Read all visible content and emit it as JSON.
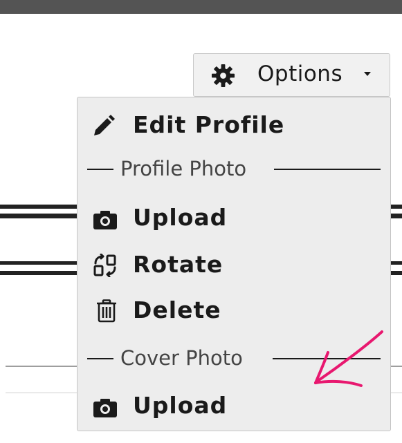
{
  "options_button": {
    "label": "Options",
    "icon": "gear-icon",
    "caret_icon": "caret-down-icon"
  },
  "menu": {
    "edit_profile": {
      "label": "Edit Profile",
      "icon": "pencil-icon"
    },
    "profile_photo_section": "Profile Photo",
    "profile_upload": {
      "label": "Upload",
      "icon": "camera-icon"
    },
    "rotate": {
      "label": "Rotate",
      "icon": "rotate-icon"
    },
    "delete": {
      "label": "Delete",
      "icon": "trash-icon"
    },
    "cover_photo_section": "Cover Photo",
    "cover_upload": {
      "label": "Upload",
      "icon": "camera-icon"
    }
  },
  "annotation": {
    "color": "#e8186f",
    "icon": "pink-arrow-annotation"
  },
  "colors": {
    "menu_bg": "#ededed",
    "button_bg": "#f1f1f1",
    "top_bar": "#545454",
    "text": "#1a1a1a"
  }
}
